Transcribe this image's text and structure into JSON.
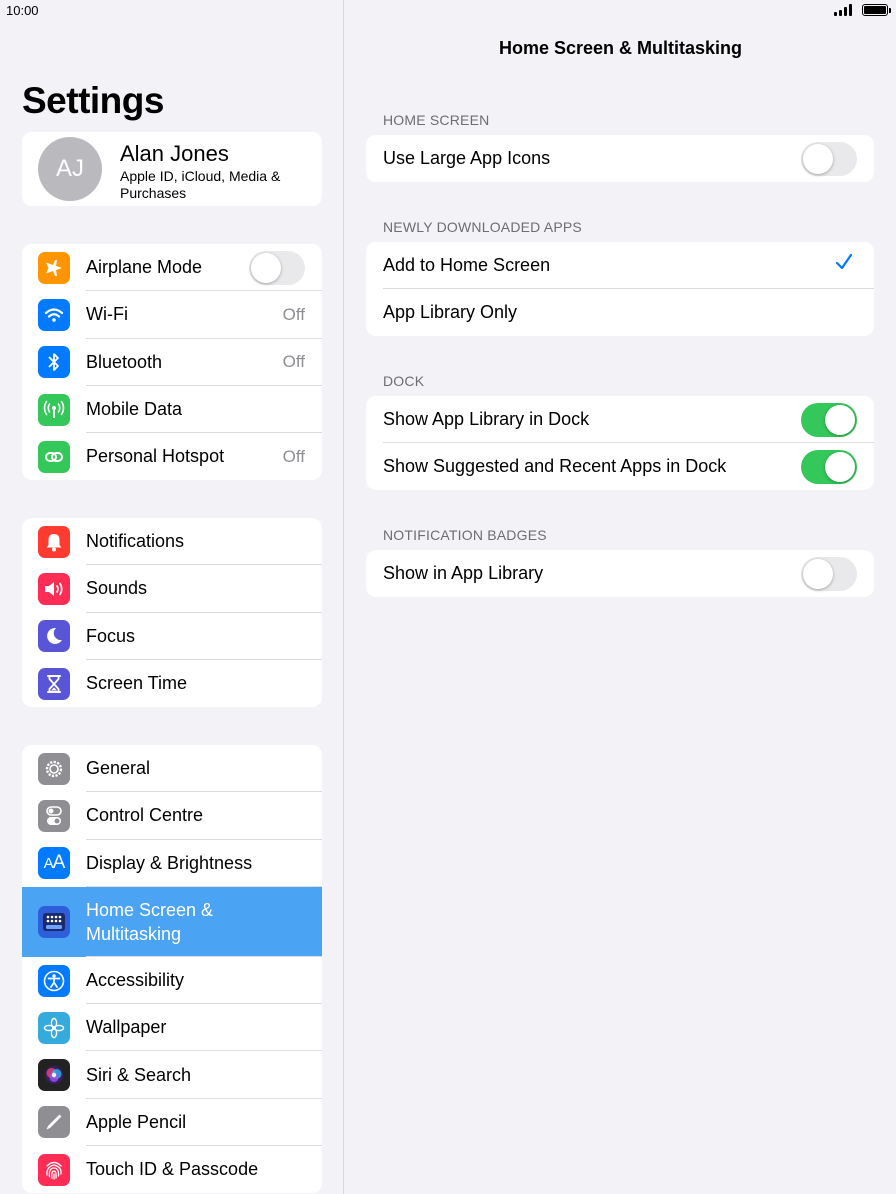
{
  "status": {
    "time": "10:00"
  },
  "sidebar": {
    "title": "Settings",
    "profile": {
      "initials": "AJ",
      "name": "Alan Jones",
      "subtitle": "Apple ID, iCloud, Media & Purchases"
    },
    "group1": [
      {
        "label": "Airplane Mode",
        "icon": "airplane-icon",
        "color": "#ff9500",
        "toggle": "off"
      },
      {
        "label": "Wi-Fi",
        "icon": "wifi-icon",
        "color": "#007aff",
        "value": "Off"
      },
      {
        "label": "Bluetooth",
        "icon": "bluetooth-icon",
        "color": "#007aff",
        "value": "Off"
      },
      {
        "label": "Mobile Data",
        "icon": "antenna-icon",
        "color": "#34c759"
      },
      {
        "label": "Personal Hotspot",
        "icon": "hotspot-icon",
        "color": "#34c759",
        "value": "Off"
      }
    ],
    "group2": [
      {
        "label": "Notifications",
        "icon": "bell-icon",
        "color": "#ff3b30"
      },
      {
        "label": "Sounds",
        "icon": "speaker-icon",
        "color": "#ff2d55"
      },
      {
        "label": "Focus",
        "icon": "moon-icon",
        "color": "#5856d6"
      },
      {
        "label": "Screen Time",
        "icon": "hourglass-icon",
        "color": "#5856d6"
      }
    ],
    "group3": [
      {
        "label": "General",
        "icon": "gear-icon",
        "color": "#8e8e93"
      },
      {
        "label": "Control Centre",
        "icon": "switches-icon",
        "color": "#8e8e93"
      },
      {
        "label": "Display & Brightness",
        "icon": "text-size-icon",
        "color": "#007aff"
      },
      {
        "label": "Home Screen &\nMultitasking",
        "icon": "home-grid-icon",
        "color": "#2c5fd9",
        "selected": true
      },
      {
        "label": "Accessibility",
        "icon": "accessibility-icon",
        "color": "#007aff"
      },
      {
        "label": "Wallpaper",
        "icon": "flower-icon",
        "color": "#35aadc"
      },
      {
        "label": "Siri & Search",
        "icon": "siri-icon",
        "color": "#222222"
      },
      {
        "label": "Apple Pencil",
        "icon": "pencil-icon",
        "color": "#8e8e93"
      },
      {
        "label": "Touch ID & Passcode",
        "icon": "fingerprint-icon",
        "color": "#ff2d55"
      }
    ]
  },
  "detail": {
    "title": "Home Screen & Multitasking",
    "sections": {
      "home_screen": {
        "header": "HOME SCREEN",
        "rows": [
          {
            "label": "Use Large App Icons",
            "toggle": "off"
          }
        ]
      },
      "newly_downloaded": {
        "header": "NEWLY DOWNLOADED APPS",
        "rows": [
          {
            "label": "Add to Home Screen",
            "checked": true
          },
          {
            "label": "App Library Only",
            "checked": false
          }
        ]
      },
      "dock": {
        "header": "DOCK",
        "rows": [
          {
            "label": "Show App Library in Dock",
            "toggle": "on"
          },
          {
            "label": "Show Suggested and Recent Apps in Dock",
            "toggle": "on"
          }
        ]
      },
      "badges": {
        "header": "NOTIFICATION BADGES",
        "rows": [
          {
            "label": "Show in App Library",
            "toggle": "off"
          }
        ]
      }
    }
  },
  "colors": {
    "accent": "#007aff",
    "toggle_on": "#34c759",
    "selected_row": "#4aa3f3"
  }
}
